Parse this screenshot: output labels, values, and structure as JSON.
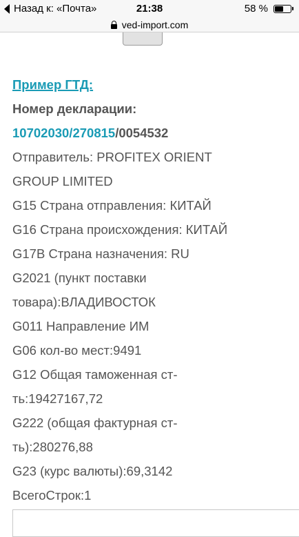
{
  "status_bar": {
    "back_label": "Назад к: «Почта»",
    "time": "21:38",
    "battery_text": "58 %",
    "battery_level": 0.58
  },
  "url_bar": {
    "domain": "ved-import.com"
  },
  "main": {
    "heading": "Пример ГТД:",
    "declaration_label": "Номер декларации:",
    "declaration_number": {
      "link_part": "10702030/270815",
      "plain_part": "/0054532"
    },
    "lines": [
      "Отправитель: PROFITEX ORIENT",
      "GROUP LIMITED",
      "G15 Страна отправления: КИТАЙ",
      "G16 Страна происхождения: КИТАЙ",
      "G17B Страна назначения: RU",
      "G2021 (пункт поставки",
      "товара):ВЛАДИВОСТОК",
      "G011 Направление ИМ",
      "G06 кол-во мест:9491",
      "G12 Общая таможенная ст-",
      "ть:19427167,72",
      "G222 (общая фактурная ст-",
      "ть):280276,88",
      "G23 (курс валюты):69,3142",
      "ВсегоСтрок:1"
    ]
  },
  "colors": {
    "accent": "#1a9bb5",
    "text": "#555555"
  }
}
